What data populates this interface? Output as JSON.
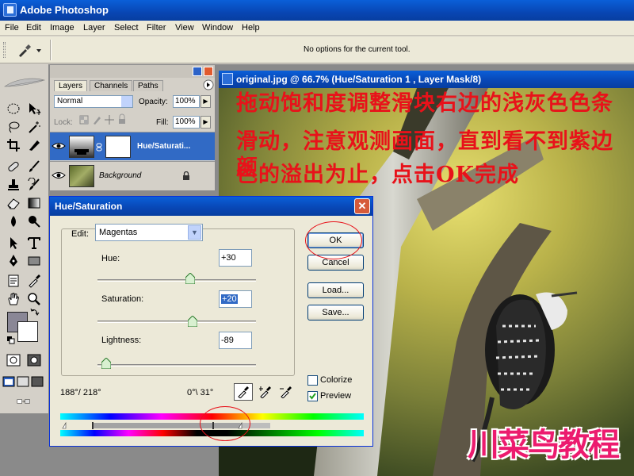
{
  "app": {
    "title": "Adobe Photoshop"
  },
  "menu": [
    "File",
    "Edit",
    "Image",
    "Layer",
    "Select",
    "Filter",
    "View",
    "Window",
    "Help"
  ],
  "options_bar": {
    "message": "No options for the current tool."
  },
  "layers_panel": {
    "tabs": [
      "Layers",
      "Channels",
      "Paths"
    ],
    "blend_mode": "Normal",
    "opacity_label": "Opacity:",
    "opacity_value": "100%",
    "lock_label": "Lock:",
    "fill_label": "Fill:",
    "fill_value": "100%",
    "layers": [
      {
        "name": "Hue/Saturati...",
        "selected": true
      },
      {
        "name": "Background",
        "selected": false
      }
    ]
  },
  "document": {
    "title": "original.jpg @ 66.7% (Hue/Saturation 1 , Layer Mask/8)"
  },
  "annotation": {
    "line1": "拖动饱和度调整滑块右边的浅灰色色条",
    "line2": "滑动，注意观测画面，直到看不到紫边颜",
    "line3": "色的溢出为止，点击OK完成"
  },
  "watermark": "川菜鸟教程",
  "dialog": {
    "title": "Hue/Saturation",
    "edit_label": "Edit:",
    "edit_value": "Magentas",
    "hue_label": "Hue:",
    "hue_value": "+30",
    "hue_level": 30,
    "saturation_label": "Saturation:",
    "saturation_value": "+20",
    "saturation_level": 20,
    "lightness_label": "Lightness:",
    "lightness_value": "-89",
    "lightness_level": -89,
    "buttons": {
      "ok": "OK",
      "cancel": "Cancel",
      "load": "Load...",
      "save": "Save..."
    },
    "colorize_label": "Colorize",
    "colorize_checked": false,
    "preview_label": "Preview",
    "preview_checked": true,
    "range_left": "188°/ 218°",
    "range_right": "0°\\ 31°"
  },
  "colors": {
    "accent_red": "#e8121a",
    "title_blue": "#0846b4",
    "watermark_pink": "#ec1b6e"
  }
}
